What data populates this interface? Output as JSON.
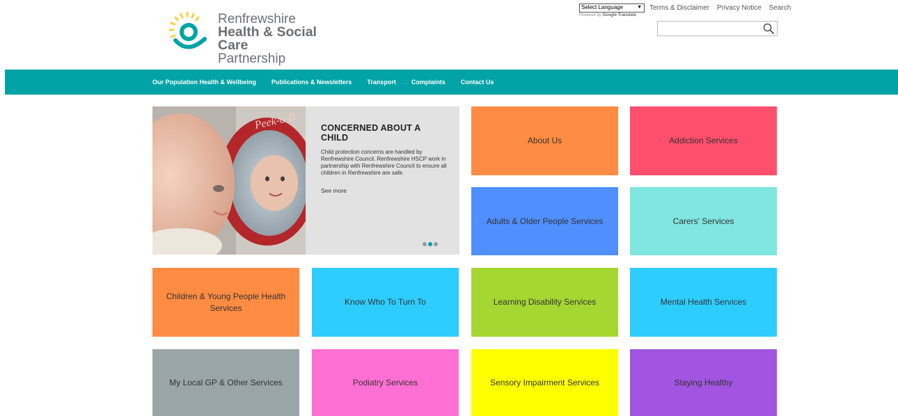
{
  "header": {
    "logo_line1": "Renfrewshire",
    "logo_line2": "Health & Social Care",
    "logo_line3": "Partnership",
    "language_select": "Select Language",
    "powered_by": "Powered by",
    "google_translate": "Google Translate",
    "links": {
      "terms": "Terms & Disclaimer",
      "privacy": "Privacy Notice",
      "search": "Search"
    },
    "search_placeholder": ""
  },
  "nav": {
    "items": [
      "Our Population Health & Wellbeing",
      "Publications & Newsletters",
      "Transport",
      "Complaints",
      "Contact Us"
    ]
  },
  "hero": {
    "title": "CONCERNED ABOUT A CHILD",
    "text": "Child protection concerns are handled by Renfrewshire Council. Renfrewshire HSCP work in partnership with Renfrewshire Council to ensure all children in Renfrewshire are safe.",
    "link": "See more",
    "photo_text": "Peek-a-B",
    "slides_total": 3,
    "active_slide": 2
  },
  "tiles": [
    {
      "label": "About Us",
      "color": "#ff8c42"
    },
    {
      "label": "Addiction Services",
      "color": "#ff4f6d"
    },
    {
      "label": "Adults & Older People Services",
      "color": "#4f8fff"
    },
    {
      "label": "Carers' Services",
      "color": "#7fe6e0"
    },
    {
      "label": "Children & Young People Health Services",
      "color": "#ff8c42"
    },
    {
      "label": "Know Who To Turn To",
      "color": "#2dcdff"
    },
    {
      "label": "Learning Disability Services",
      "color": "#a5d631"
    },
    {
      "label": "Mental Health Services",
      "color": "#2dcdff"
    },
    {
      "label": "My Local GP & Other Services",
      "color": "#9aa5a8"
    },
    {
      "label": "Podiatry Services",
      "color": "#ff6fd4"
    },
    {
      "label": "Sensory Impairment Services",
      "color": "#ffff00"
    },
    {
      "label": "Staying Healthy",
      "color": "#a155e0"
    }
  ],
  "colors": {
    "brand_teal": "#00a3a6",
    "logo_yellow": "#f5d33c"
  }
}
